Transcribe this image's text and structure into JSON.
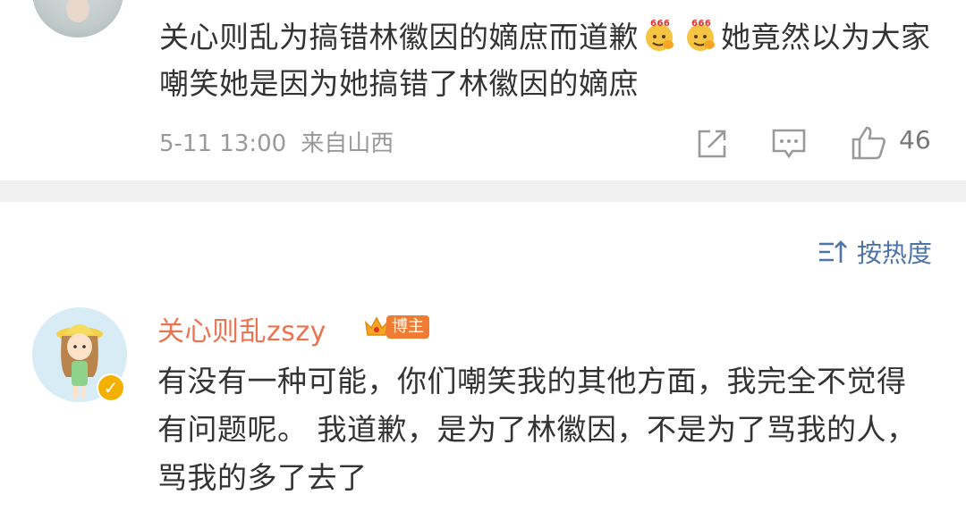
{
  "top_comment": {
    "text_part1": "关心则乱为搞错林徽因的嫡庶而道歉",
    "emoji_name": "666-emoji",
    "text_part2": "她竟然以为大家嘲笑她是因为她搞错了林徽因的嫡庶",
    "timestamp": "5-11 13:00",
    "location": "来自山西",
    "like_count": "46"
  },
  "sort": {
    "label": "按热度"
  },
  "reply": {
    "username": "关心则乱zszy",
    "badge_label": "博主",
    "text": "有没有一种可能，你们嘲笑我的其他方面，我完全不觉得有问题呢。 我道歉，是为了林徽因，不是为了骂我的人，骂我的多了去了"
  },
  "colors": {
    "username": "#eb7350",
    "link_blue": "#4d74a6",
    "meta_gray": "#999999",
    "badge_orange": "#f07c33"
  }
}
